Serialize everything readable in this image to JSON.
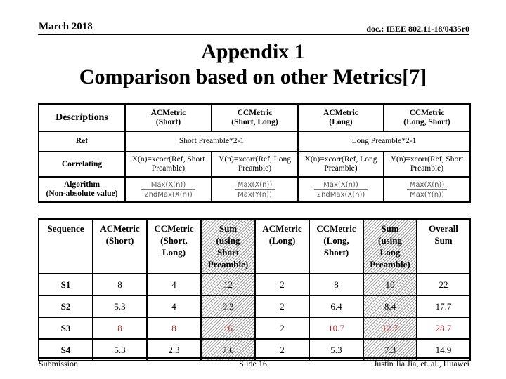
{
  "header": {
    "date": "March 2018",
    "doc_id": "doc.: IEEE 802.11-18/0435r0"
  },
  "title": {
    "line1": "Appendix 1",
    "line2": "Comparison based on other Metrics[7]"
  },
  "descriptions_table": {
    "columns": [
      "Descriptions",
      "ACMetric (Short)",
      "CCMetric (Short, Long)",
      "ACMetric (Long)",
      "CCMetric (Long, Short)"
    ],
    "col_lines": [
      [
        "Descriptions"
      ],
      [
        "ACMetric",
        "(Short)"
      ],
      [
        "CCMetric",
        "(Short, Long)"
      ],
      [
        "ACMetric",
        "(Long)"
      ],
      [
        "CCMetric",
        "(Long, Short)"
      ]
    ],
    "ref": {
      "label": "Ref",
      "short": "Short Preamble*2-1",
      "long": "Long Preamble*2-1"
    },
    "correlating": {
      "label": "Correlating",
      "cells": [
        "X(n)=xcorr(Ref, Short Preamble)",
        "Y(n)=xcorr(Ref, Long Preamble)",
        "X(n)=xcorr(Ref, Long Preamble)",
        "Y(n)=xcorr(Ref, Short Preamble)"
      ]
    },
    "algorithm": {
      "label_line1": "Algorithm",
      "label_line2": "(Non-absolute value)",
      "cells": [
        {
          "num": "Max(X(n))",
          "den": "2ndMax(X(n))"
        },
        {
          "num": "Max(X(n))",
          "den": "Max(Y(n))"
        },
        {
          "num": "Max(X(n))",
          "den": "2ndMax(X(n))"
        },
        {
          "num": "Max(X(n))",
          "den": "Max(Y(n))"
        }
      ]
    }
  },
  "results_table": {
    "headers": [
      [
        "Sequence"
      ],
      [
        "ACMetric",
        "(Short)"
      ],
      [
        "CCMetric",
        "(Short,",
        "Long)"
      ],
      [
        "Sum",
        "(using",
        "Short",
        "Preamble)"
      ],
      [
        "ACMetric",
        "(Long)"
      ],
      [
        "CCMetric",
        "(Long,",
        "Short)"
      ],
      [
        "Sum",
        "(using",
        "Long",
        "Preamble)"
      ],
      [
        "Overall",
        "Sum"
      ]
    ],
    "rows": [
      {
        "seq": "S1",
        "values": [
          "8",
          "4",
          "12",
          "2",
          "8",
          "10",
          "22"
        ],
        "highlight": false
      },
      {
        "seq": "S2",
        "values": [
          "5.3",
          "4",
          "9.3",
          "2",
          "6.4",
          "8.4",
          "17.7"
        ],
        "highlight": false
      },
      {
        "seq": "S3",
        "values": [
          "8",
          "8",
          "16",
          "2",
          "10.7",
          "12.7",
          "28.7"
        ],
        "highlight": true,
        "highlight_cols": [
          0,
          1,
          2,
          4,
          5,
          6
        ]
      },
      {
        "seq": "S4",
        "values": [
          "5.3",
          "2.3",
          "7.6",
          "2",
          "5.3",
          "7.3",
          "14.9"
        ],
        "highlight": false
      }
    ],
    "highlight_color": "#b03030",
    "hatched_columns": [
      3,
      6
    ]
  },
  "footer": {
    "left": "Submission",
    "center": "Slide 16",
    "right": "Justin Jia Jia, et. al., Huawei"
  }
}
